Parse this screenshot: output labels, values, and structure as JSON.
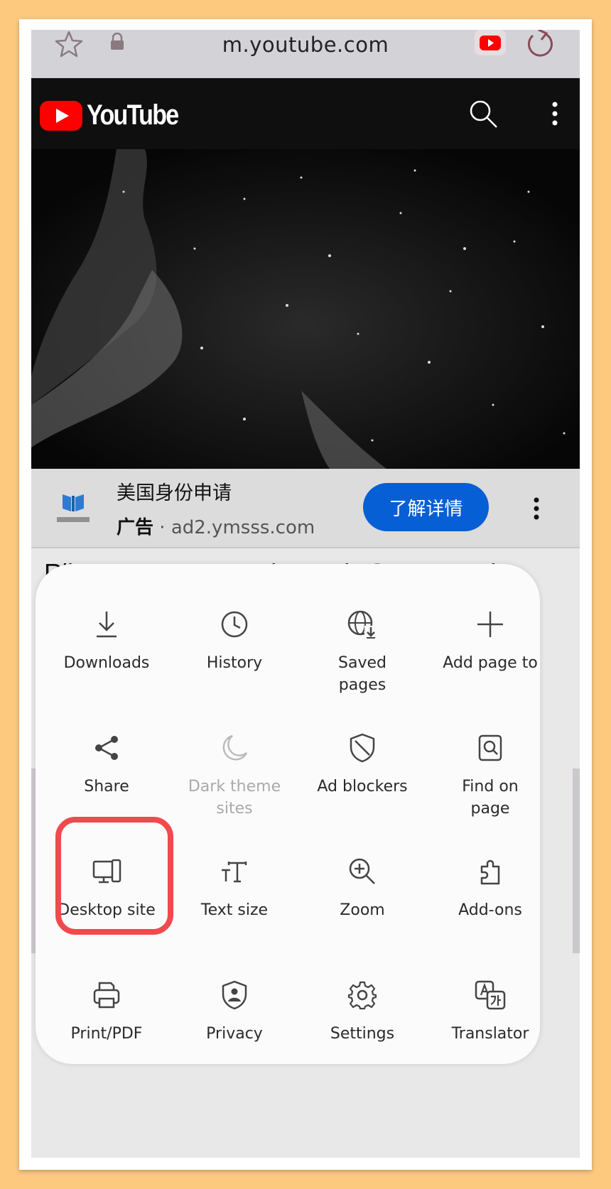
{
  "browser": {
    "url": "m.youtube.com"
  },
  "youtube": {
    "logo_text": "YouTube"
  },
  "ad": {
    "title": "美国身份申请",
    "label": "广告",
    "separator": "·",
    "domain": "ad2.ymsss.com",
    "cta": "了解详情"
  },
  "video": {
    "title_partial": "Rihanna’s FULL Apple Music Super Bowl"
  },
  "menu": {
    "items": [
      {
        "label": "Downloads",
        "icon": "download-icon"
      },
      {
        "label": "History",
        "icon": "clock-icon"
      },
      {
        "label": "Saved pages",
        "icon": "globe-download-icon"
      },
      {
        "label": "Add page to",
        "icon": "plus-icon"
      },
      {
        "label": "Share",
        "icon": "share-icon"
      },
      {
        "label": "Dark theme sites",
        "icon": "moon-icon"
      },
      {
        "label": "Ad blockers",
        "icon": "shield-slash-icon"
      },
      {
        "label": "Find on page",
        "icon": "find-page-icon"
      },
      {
        "label": "Desktop site",
        "icon": "desktop-icon"
      },
      {
        "label": "Text size",
        "icon": "text-size-icon"
      },
      {
        "label": "Zoom",
        "icon": "zoom-in-icon"
      },
      {
        "label": "Add-ons",
        "icon": "puzzle-icon"
      },
      {
        "label": "Print/PDF",
        "icon": "printer-icon"
      },
      {
        "label": "Privacy",
        "icon": "privacy-shield-icon"
      },
      {
        "label": "Settings",
        "icon": "gear-icon"
      },
      {
        "label": "Translator",
        "icon": "translate-icon"
      }
    ]
  },
  "colors": {
    "highlight": "#ef4a4d",
    "cta": "#065fd4",
    "yt_red": "#ff0000"
  }
}
